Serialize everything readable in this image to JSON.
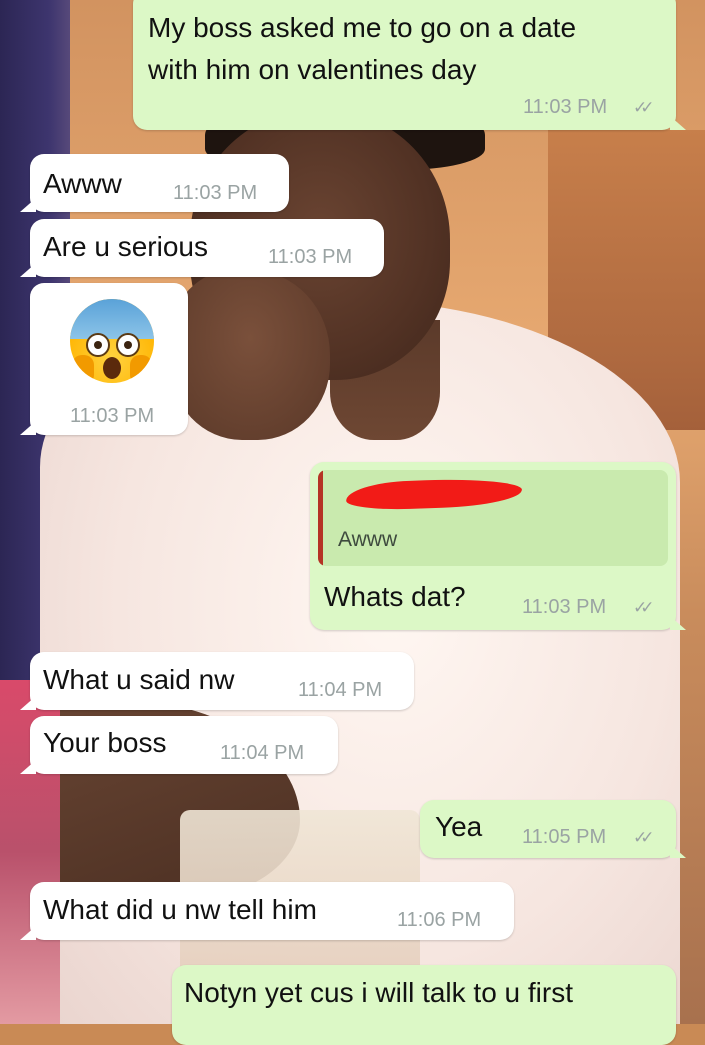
{
  "chat": {
    "messages": [
      {
        "direction": "outgoing",
        "text_lines": [
          "My boss asked me to go on a date",
          "with him on valentines day"
        ],
        "time": "11:03 PM",
        "ticks": "✓✓"
      },
      {
        "direction": "incoming",
        "text": "Awww",
        "time": "11:03 PM"
      },
      {
        "direction": "incoming",
        "text": "Are u serious",
        "time": "11:03 PM"
      },
      {
        "direction": "incoming",
        "emoji": "screaming-in-fear-emoji",
        "time": "11:03 PM"
      },
      {
        "direction": "outgoing",
        "quote": {
          "author": "[redacted]",
          "text": "Awww",
          "bar_color": "#b53325"
        },
        "text": "Whats dat?",
        "time": "11:03 PM",
        "ticks": "✓✓"
      },
      {
        "direction": "incoming",
        "text": "What u said nw",
        "time": "11:04 PM"
      },
      {
        "direction": "incoming",
        "text": "Your boss",
        "time": "11:04 PM"
      },
      {
        "direction": "outgoing",
        "text": "Yea",
        "time": "11:05 PM",
        "ticks": "✓✓"
      },
      {
        "direction": "incoming",
        "text": "What did u nw tell him",
        "time": "11:06 PM"
      },
      {
        "direction": "outgoing",
        "text": "Notyn yet cus i will talk to u first",
        "time": "",
        "ticks": ""
      }
    ]
  },
  "colors": {
    "incoming_bubble": "#ffffff",
    "outgoing_bubble": "#dcf8c6",
    "timestamp": "#9aa3a3",
    "redaction": "#f21b17"
  }
}
